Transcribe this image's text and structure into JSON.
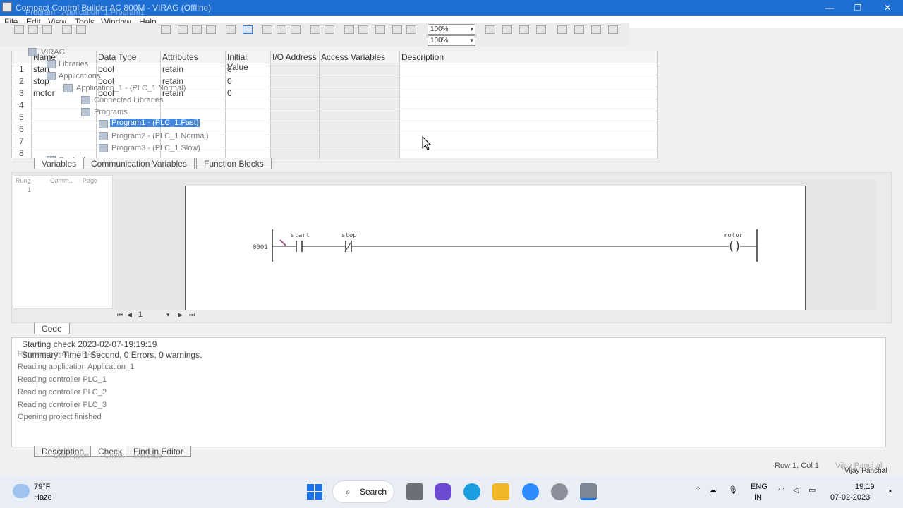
{
  "window": {
    "title": "Compact Control Builder AC 800M - VIRAG    (Offline)",
    "subtitle": "Program - Application_1.Program1"
  },
  "menu": [
    "File",
    "Edit",
    "View",
    "Tools",
    "Window",
    "Help"
  ],
  "toolbar": {
    "zoom1": "100%",
    "zoom2": "100%"
  },
  "tree": {
    "root": "VIRAG",
    "libraries": "Libraries",
    "applications": "Applications",
    "application1": "Application_1 - (PLC_1.Normal)",
    "connected_libraries": "Connected Libraries",
    "programs": "Programs",
    "program1": "Program1 - (PLC_1.Fast)",
    "program2": "Program2 - (PLC_1.Normal)",
    "program3": "Program3 - (PLC_1.Slow)",
    "controllers": "Controllers"
  },
  "variables": {
    "columns": [
      "Name",
      "Data Type",
      "Attributes",
      "Initial Value",
      "I/O Address",
      "Access Variables",
      "Description"
    ],
    "rows": [
      {
        "num": "1",
        "name": "start",
        "type": "bool",
        "attr": "retain",
        "init": "0"
      },
      {
        "num": "2",
        "name": "stop",
        "type": "bool",
        "attr": "retain",
        "init": "0"
      },
      {
        "num": "3",
        "name": "motor",
        "type": "bool",
        "attr": "retain",
        "init": "0"
      },
      {
        "num": "4",
        "name": "",
        "type": "",
        "attr": "",
        "init": ""
      },
      {
        "num": "5",
        "name": "",
        "type": "",
        "attr": "",
        "init": ""
      },
      {
        "num": "6",
        "name": "",
        "type": "",
        "attr": "",
        "init": ""
      },
      {
        "num": "7",
        "name": "",
        "type": "",
        "attr": "",
        "init": ""
      },
      {
        "num": "8",
        "name": "",
        "type": "",
        "attr": "",
        "init": ""
      }
    ],
    "tabs": [
      "Variables",
      "Communication Variables",
      "Function Blocks"
    ]
  },
  "code": {
    "rung_columns": [
      "Rung",
      "Comm...",
      "Page"
    ],
    "rung_row": "1",
    "rung_number": "0001",
    "contacts": [
      {
        "label": "start",
        "kind": "no"
      },
      {
        "label": "stop",
        "kind": "nc"
      }
    ],
    "coil": "motor",
    "page_value": "1",
    "tab": "Code"
  },
  "messages": {
    "overlay_1": "Starting check 2023-02-07-19:19:19",
    "overlay_2": "Summary: Time 1 Second, 0 Errors, 0 warnings.",
    "faded_1": "Reading project VIRAG",
    "lines": [
      "Reading application Application_1",
      "Reading controller PLC_1",
      "Reading controller PLC_2",
      "Reading controller PLC_3",
      "Opening project finished"
    ],
    "tabs": [
      "Description",
      "Check",
      "Find in Editor"
    ],
    "tabs_faded": [
      "Description",
      "Check",
      "Message"
    ]
  },
  "status": {
    "position": "Row 1, Col 1",
    "user_faded": "Vijay Panchal",
    "user": "Vijay Panchal"
  },
  "taskbar": {
    "weather_temp": "79°F",
    "weather_desc": "Haze",
    "search_label": "Search",
    "lang1": "ENG",
    "lang2": "IN",
    "time": "19:19",
    "date": "07-02-2023"
  }
}
